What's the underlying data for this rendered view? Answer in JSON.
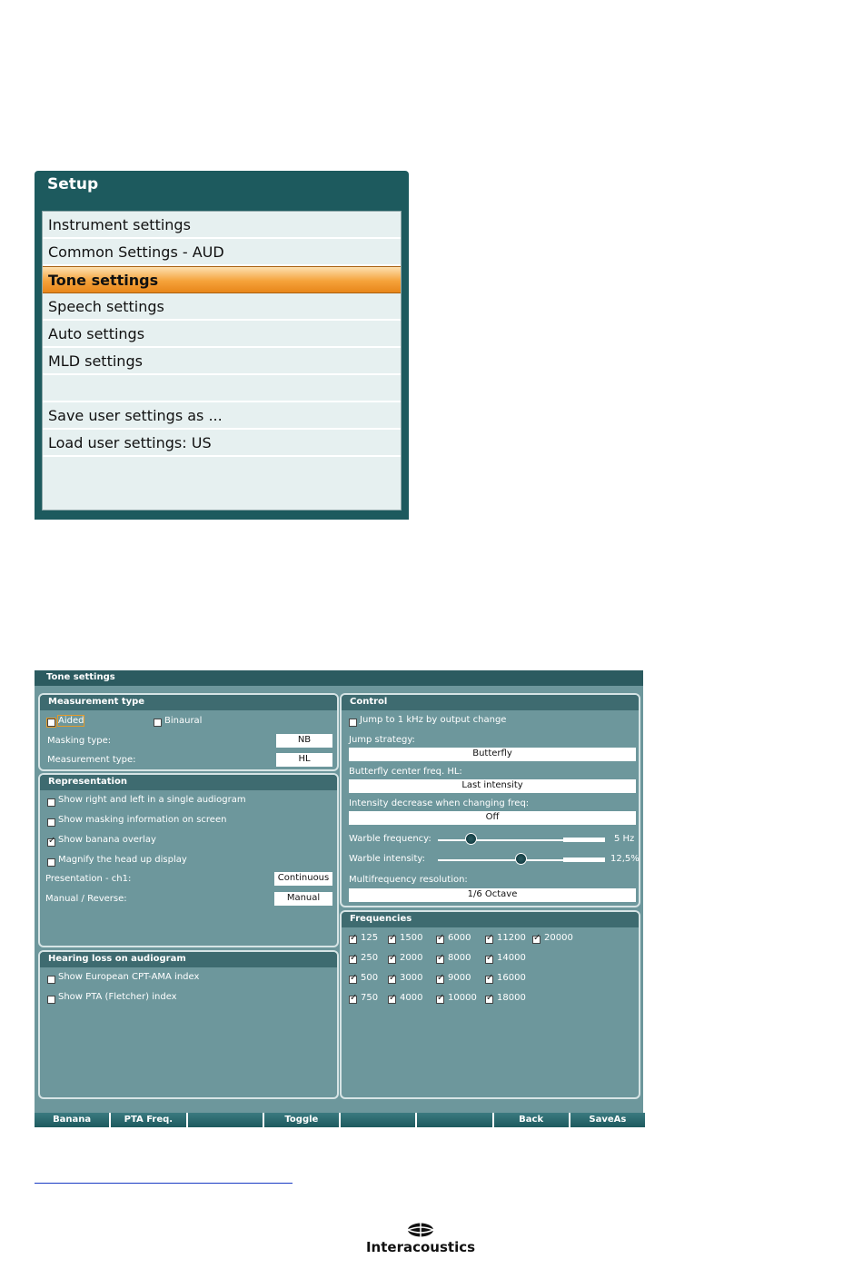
{
  "setup": {
    "title": "Setup",
    "items": [
      {
        "label": "Instrument settings"
      },
      {
        "label": "Common Settings - AUD"
      },
      {
        "label": "Tone settings",
        "selected": true
      },
      {
        "label": "Speech settings"
      },
      {
        "label": "Auto settings"
      },
      {
        "label": "MLD settings"
      },
      {
        "label": ""
      },
      {
        "label": "Save user settings as ..."
      },
      {
        "label": "Load user settings: US"
      }
    ]
  },
  "tone": {
    "title": "Tone settings",
    "measurement": {
      "title": "Measurement type",
      "aided": {
        "label": "Aided",
        "checked": false
      },
      "binaural": {
        "label": "Binaural",
        "checked": false
      },
      "masking_type": {
        "label": "Masking type:",
        "value": "NB"
      },
      "measurement_type": {
        "label": "Measurement type:",
        "value": "HL"
      }
    },
    "representation": {
      "title": "Representation",
      "options": [
        {
          "label": "Show right and left in a single audiogram",
          "checked": false
        },
        {
          "label": "Show masking information on screen",
          "checked": false
        },
        {
          "label": "Show banana overlay",
          "checked": true
        },
        {
          "label": "Magnify the head up display",
          "checked": false
        }
      ],
      "presentation": {
        "label": "Presentation - ch1:",
        "value": "Continuous"
      },
      "manual_reverse": {
        "label": "Manual / Reverse:",
        "value": "Manual"
      }
    },
    "hearing_loss": {
      "title": "Hearing loss on audiogram",
      "options": [
        {
          "label": "Show European CPT-AMA index",
          "checked": false
        },
        {
          "label": "Show PTA (Fletcher) index",
          "checked": false
        }
      ]
    },
    "control": {
      "title": "Control",
      "jump_1khz": {
        "label": "Jump to 1 kHz by output change",
        "checked": false
      },
      "jump_strategy": {
        "label": "Jump strategy:",
        "value": "Butterfly"
      },
      "butterfly_center": {
        "label": "Butterfly center freq. HL:",
        "value": "Last intensity"
      },
      "intensity_decrease": {
        "label": "Intensity decrease when changing freq:",
        "value": "Off"
      },
      "warble_frequency": {
        "label": "Warble frequency:",
        "value": "5 Hz",
        "position": 0.2
      },
      "warble_intensity": {
        "label": "Warble intensity:",
        "value": "12,5%",
        "position": 0.5
      },
      "multifrequency": {
        "label": "Multifrequency resolution:",
        "value": "1/6 Octave"
      }
    },
    "frequencies": {
      "title": "Frequencies",
      "columns": [
        [
          "125",
          "250",
          "500",
          "750"
        ],
        [
          "1500",
          "2000",
          "3000",
          "4000"
        ],
        [
          "6000",
          "8000",
          "9000",
          "10000"
        ],
        [
          "11200",
          "14000",
          "16000",
          "18000"
        ],
        [
          "20000"
        ]
      ]
    }
  },
  "bottom_bar": [
    "Banana",
    "PTA Freq.",
    "",
    "Toggle",
    "",
    "",
    "Back",
    "SaveAs"
  ],
  "footer": {
    "brand": "Interacoustics"
  }
}
